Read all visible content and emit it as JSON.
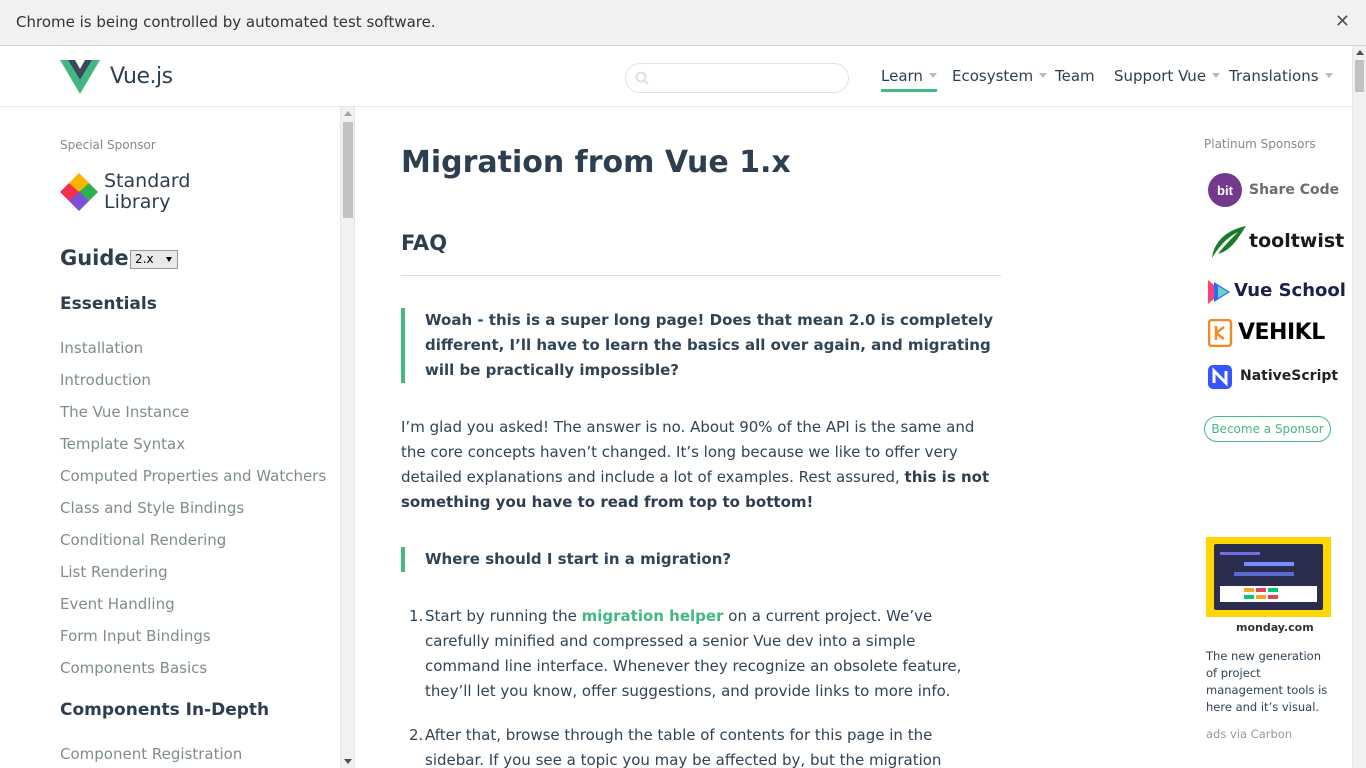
{
  "infobar": {
    "message": "Chrome is being controlled by automated test software.",
    "close": "✕"
  },
  "header": {
    "logo_text": "Vue.js",
    "search": {
      "placeholder": "",
      "value": ""
    },
    "nav": [
      {
        "label": "Learn",
        "active": true,
        "dropdown": true
      },
      {
        "label": "Ecosystem",
        "dropdown": true
      },
      {
        "label": "Team",
        "dropdown": false
      },
      {
        "label": "Support Vue",
        "dropdown": true
      },
      {
        "label": "Translations",
        "dropdown": true
      }
    ]
  },
  "sidebar": {
    "special_sponsor_label": "Special Sponsor",
    "special_sponsor_line1": "Standard",
    "special_sponsor_line2": "Library",
    "guide_title": "Guide",
    "version": "2.x",
    "sections": [
      {
        "title": "Essentials",
        "items": [
          "Installation",
          "Introduction",
          "The Vue Instance",
          "Template Syntax",
          "Computed Properties and Watchers",
          "Class and Style Bindings",
          "Conditional Rendering",
          "List Rendering",
          "Event Handling",
          "Form Input Bindings",
          "Components Basics"
        ]
      },
      {
        "title": "Components In-Depth",
        "items": [
          "Component Registration"
        ]
      }
    ]
  },
  "content": {
    "title": "Migration from Vue 1.x",
    "faq_heading": "FAQ",
    "question1": "Woah - this is a super long page! Does that mean 2.0 is completely different, I’ll have to learn the basics all over again, and migrating will be practically impossible?",
    "answer1_text": "I’m glad you asked! The answer is no. About 90% of the API is the same and the core concepts haven’t changed. It’s long because we like to offer very detailed explanations and include a lot of examples. Rest assured,",
    "answer1_bold": "this is not something you have to read from top to bottom!",
    "question2": "Where should I start in a migration?",
    "steps": [
      {
        "num": "1.",
        "before": "Start by running the",
        "link": "migration helper",
        "after": "on a current project. We’ve carefully minified and compressed a senior Vue dev into a simple command line interface. Whenever they recognize an obsolete feature, they’ll let you know, offer suggestions, and provide links to more info."
      },
      {
        "num": "2.",
        "before": "After that, browse through the table of contents for this page in the sidebar. If you see a topic you may be affected by, but the migration helper didn’t catch, check it",
        "link": "",
        "after": ""
      }
    ]
  },
  "right": {
    "platinum_label": "Platinum Sponsors",
    "sponsors": [
      {
        "name": "Share Code",
        "badge": "bit",
        "color": "#73398d"
      },
      {
        "name": "tooltwist",
        "color": "#1a7a28"
      },
      {
        "name": "Vue School",
        "color": "#1b1f4d"
      },
      {
        "name": "VEHIKL",
        "color": "#000000"
      },
      {
        "name": "NativeScript",
        "color": "#3655ff"
      }
    ],
    "become_sponsor": "Become a Sponsor",
    "ad_brand": "monday.com",
    "ad_text": "The new generation of project management tools is here and it’s visual.",
    "ad_via": "ads via Carbon"
  },
  "colors": {
    "accent": "#42b983",
    "text": "#2c3e50",
    "muted": "#7f8c8d"
  }
}
